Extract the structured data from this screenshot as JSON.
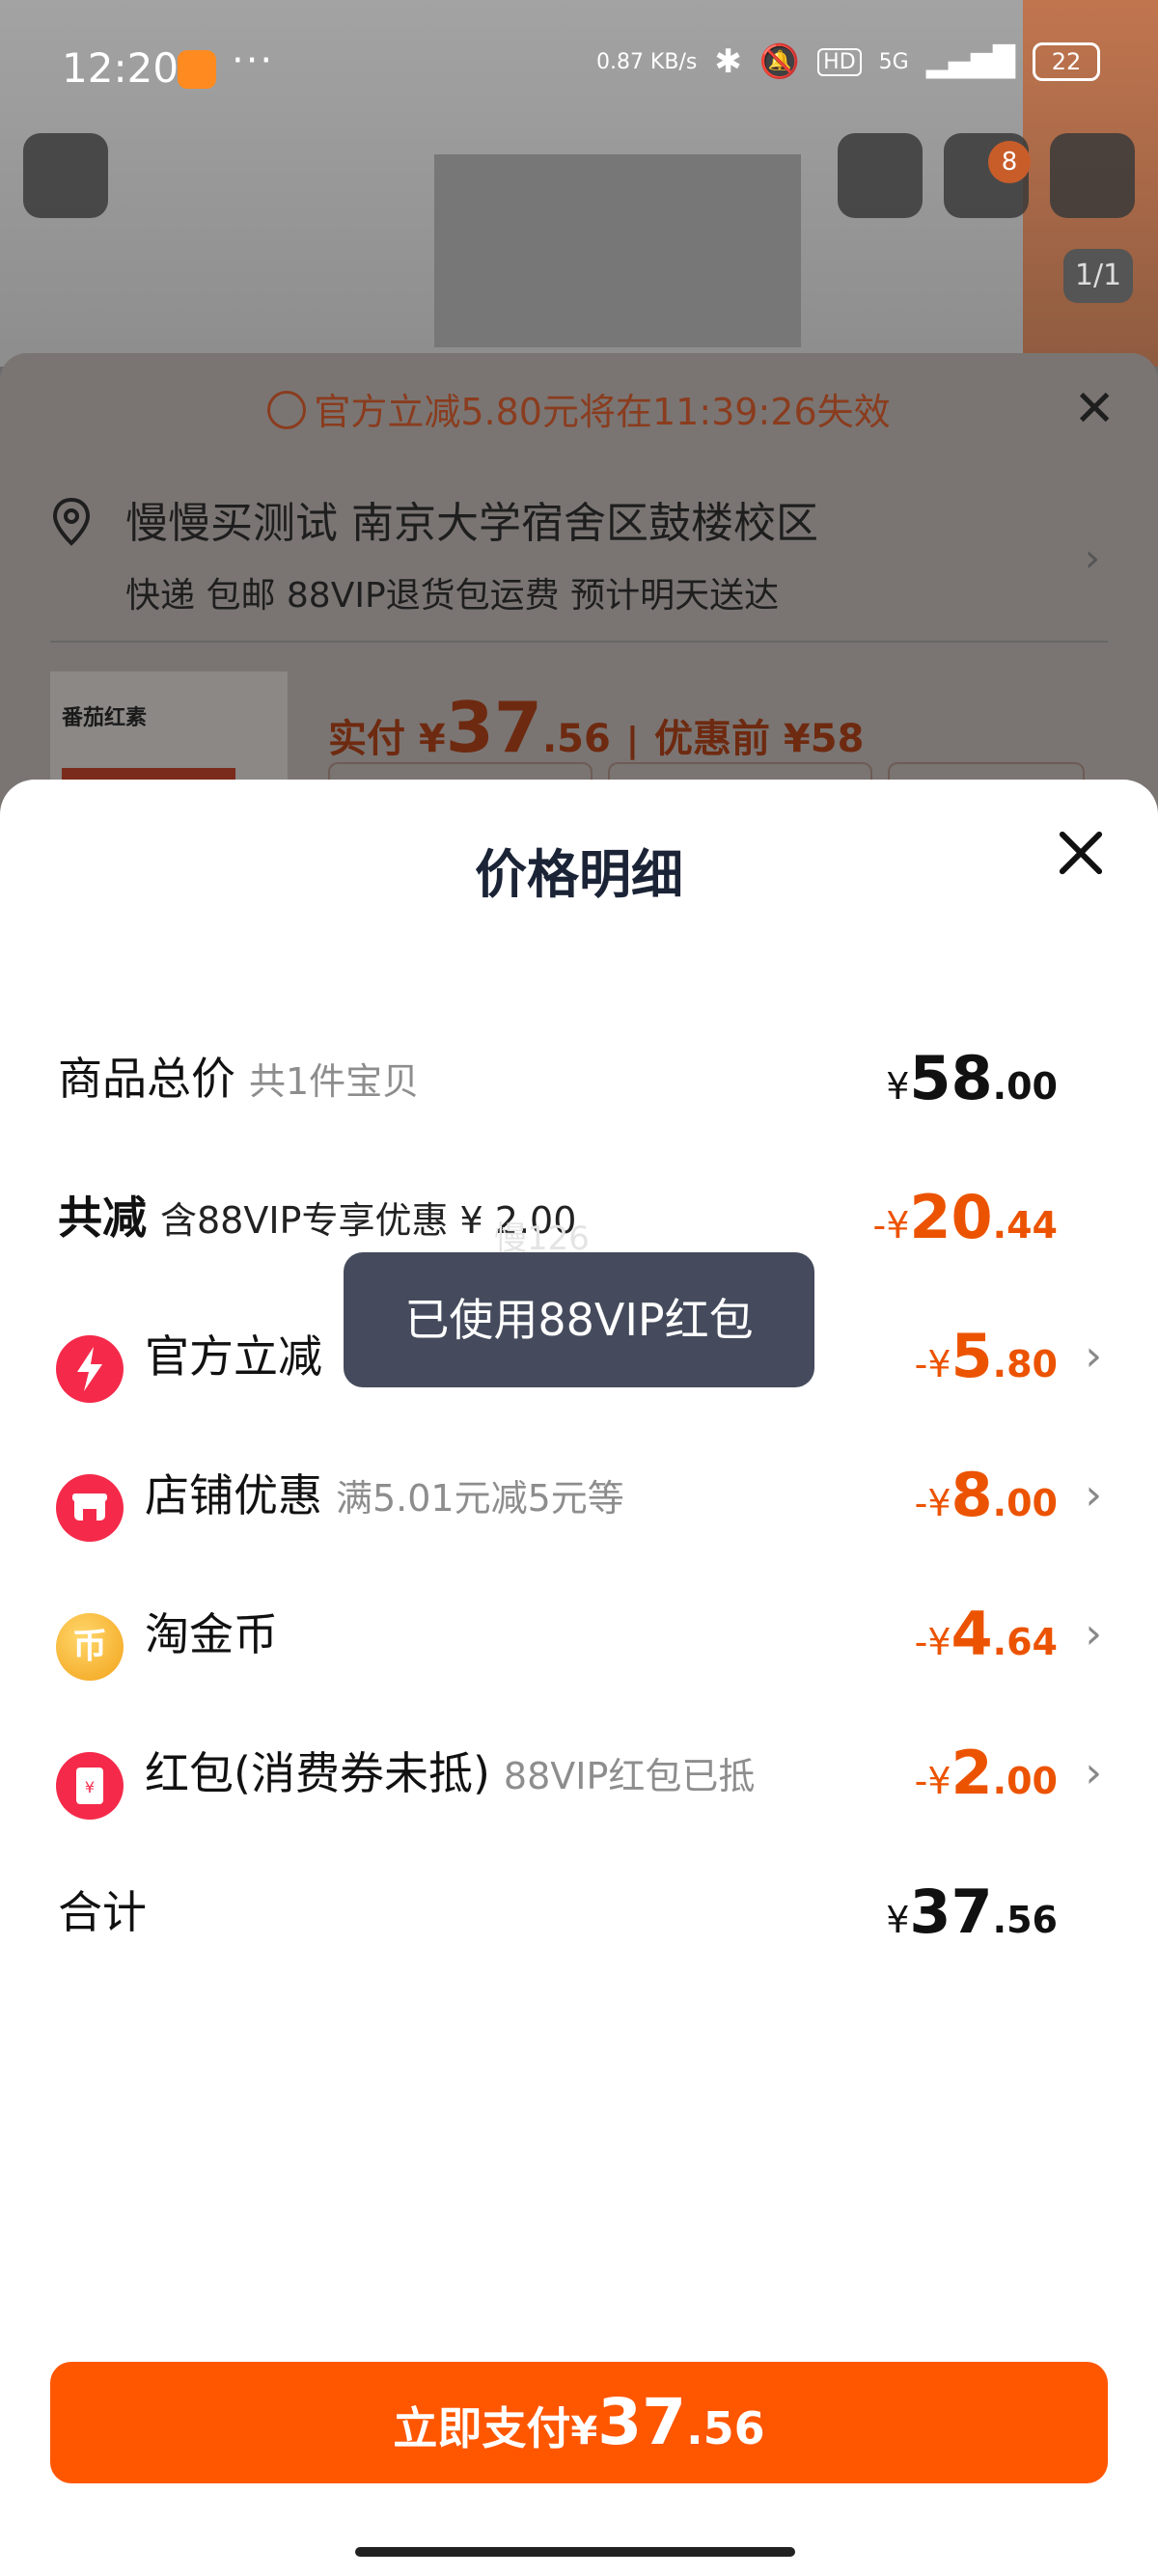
{
  "status_bar": {
    "time": "12:20",
    "net_speed": "0.87 KB/s",
    "hd": "HD",
    "signal": "5G",
    "battery": "22"
  },
  "background": {
    "cart_count": "8",
    "image_counter": "1/1",
    "countdown": "官方立减5.80元将在11:39:26失效",
    "address_line1": "慢慢买测试 南京大学宿舍区鼓楼校区",
    "address_line2": "快递 包邮 88VIP退货包运费 预计明天送达",
    "product_label": "番茄红素",
    "pay_label": "实付 ¥",
    "pay_int": "37",
    "pay_dec": ".56",
    "pay_sep": "|",
    "pay_prev": "优惠前 ¥58"
  },
  "modal": {
    "title": "价格明细",
    "rows": [
      {
        "label": "商品总价",
        "sub": "共1件宝贝",
        "sym": "¥",
        "int": "58",
        "dec": ".00"
      },
      {
        "label": "共减",
        "sub": "含88VIP专享优惠 ¥ 2.00",
        "sym": "-¥",
        "int": "20",
        "dec": ".44"
      },
      {
        "label": "官方立减",
        "sub": "",
        "sym": "-¥",
        "int": "5",
        "dec": ".80",
        "icon": "lightning-icon"
      },
      {
        "label": "店铺优惠",
        "sub": "满5.01元减5元等",
        "sym": "-¥",
        "int": "8",
        "dec": ".00",
        "icon": "shop-icon"
      },
      {
        "label": "淘金币",
        "sub": "",
        "sym": "-¥",
        "int": "4",
        "dec": ".64",
        "icon": "coin-icon"
      },
      {
        "label": "红包(消费券未抵)",
        "sub": "88VIP红包已抵",
        "sym": "-¥",
        "int": "2",
        "dec": ".00",
        "icon": "red-packet-icon"
      },
      {
        "label": "合计",
        "sub": "",
        "sym": "¥",
        "int": "37",
        "dec": ".56"
      }
    ],
    "toast": "已使用88VIP红包",
    "watermark": "慢126",
    "pay_button": {
      "text": "立即支付",
      "sym": "¥",
      "int": "37",
      "dec": ".56"
    }
  },
  "colors": {
    "accent": "#ff5600",
    "discount": "#ec5300",
    "toast_bg": "#454b5c",
    "icon_red": "#f52a4a"
  }
}
